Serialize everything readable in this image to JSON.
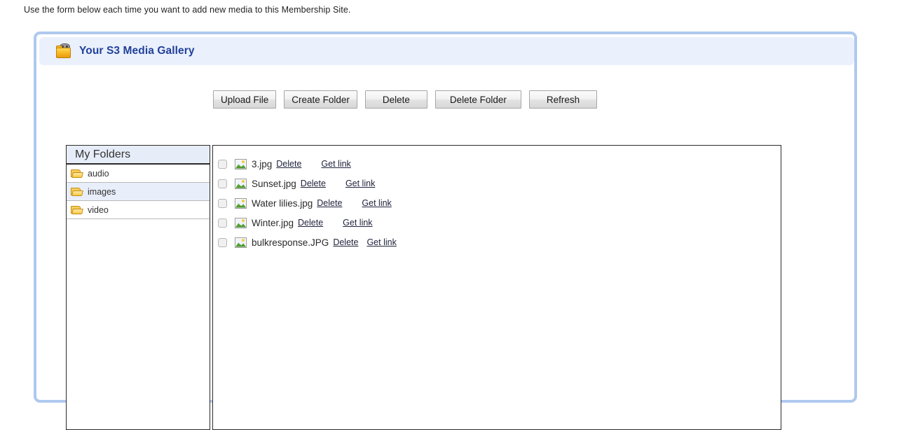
{
  "intro": {
    "text": "Use the form below each time you want to add new media to this Membership Site."
  },
  "panel": {
    "title": "Your S3 Media Gallery",
    "title_icon": "media-folder-icon",
    "title_color": "#21409a",
    "border_color": "#afc9ef",
    "header_bg": "#eaf0fc"
  },
  "toolbar": {
    "buttons": [
      {
        "label": "Upload File"
      },
      {
        "label": "Create Folder"
      },
      {
        "label": "Delete"
      },
      {
        "label": "Delete Folder"
      },
      {
        "label": "Refresh"
      }
    ]
  },
  "folders": {
    "title": "My Folders",
    "selected_bg": "#e8eefa",
    "items": [
      {
        "label": "audio",
        "icon": "folder-icon",
        "selected": false
      },
      {
        "label": "images",
        "icon": "folder-icon",
        "selected": true
      },
      {
        "label": "video",
        "icon": "folder-icon",
        "selected": false
      }
    ]
  },
  "files": {
    "actions": {
      "delete": "Delete",
      "get_link": "Get link"
    },
    "items": [
      {
        "name": "3.jpg",
        "icon": "image-file-icon",
        "checked": false,
        "delete": "Delete",
        "get_link": "Get link"
      },
      {
        "name": "Sunset.jpg",
        "icon": "image-file-icon",
        "checked": false,
        "delete": "Delete",
        "get_link": "Get link"
      },
      {
        "name": "Water lilies.jpg",
        "icon": "image-file-icon",
        "checked": false,
        "delete": "Delete",
        "get_link": "Get link"
      },
      {
        "name": "Winter.jpg",
        "icon": "image-file-icon",
        "checked": false,
        "delete": "Delete",
        "get_link": "Get link"
      },
      {
        "name": "bulkresponse.JPG",
        "icon": "image-file-icon",
        "checked": false,
        "delete": "Delete",
        "get_link": "Get link"
      }
    ]
  }
}
